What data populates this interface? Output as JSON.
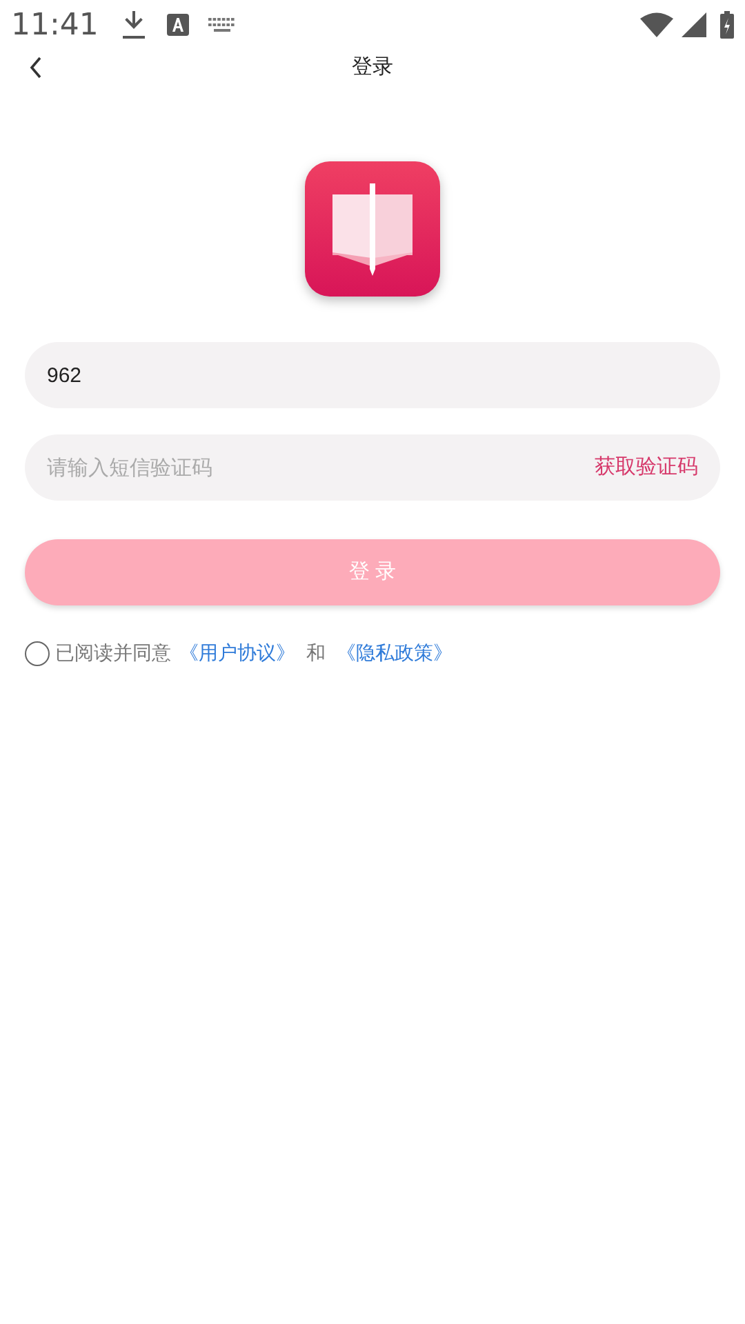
{
  "status_bar": {
    "time": "11:41"
  },
  "header": {
    "title": "登录"
  },
  "phone_field": {
    "value": "962"
  },
  "code_field": {
    "placeholder": "请输入短信验证码",
    "action": "获取验证码"
  },
  "login_button": {
    "label": "登 录",
    "disabled": true
  },
  "agreement": {
    "checked": false,
    "text": "已阅读并同意",
    "links": [
      "《用户协议》",
      "《隐私政策》"
    ],
    "joiner": "和"
  }
}
